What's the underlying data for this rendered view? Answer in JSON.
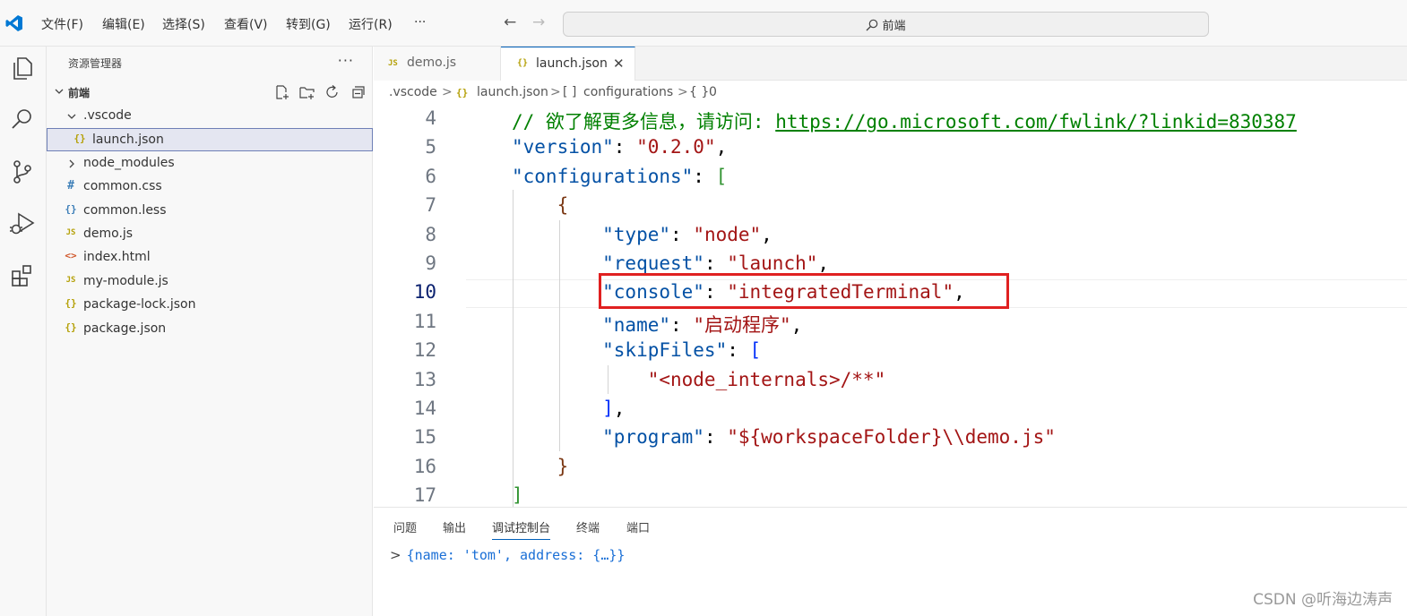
{
  "titlebar": {
    "menus": [
      "文件(F)",
      "编辑(E)",
      "选择(S)",
      "查看(V)",
      "转到(G)",
      "运行(R)",
      "···"
    ],
    "search_text": "前端"
  },
  "sidebar": {
    "title": "资源管理器",
    "more": "···",
    "folder": "前端",
    "items": [
      {
        "icon": "chevron",
        "label": ".vscode"
      },
      {
        "icon": "{}",
        "label": "launch.json"
      },
      {
        "icon": "chevron",
        "label": "node_modules"
      },
      {
        "icon": "#",
        "label": "common.css"
      },
      {
        "icon": "{}",
        "label": "common.less"
      },
      {
        "icon": "JS",
        "label": "demo.js"
      },
      {
        "icon": "<>",
        "label": "index.html"
      },
      {
        "icon": "JS",
        "label": "my-module.js"
      },
      {
        "icon": "{}",
        "label": "package-lock.json"
      },
      {
        "icon": "{}",
        "label": "package.json"
      }
    ]
  },
  "tabs": [
    {
      "icon": "JS",
      "label": "demo.js",
      "active": false
    },
    {
      "icon": "{}",
      "label": "launch.json",
      "active": true,
      "close": "✕"
    }
  ],
  "breadcrumb": [
    ".vscode",
    ">",
    "{}",
    "launch.json",
    ">",
    "[ ]",
    "configurations",
    ">",
    "{ }",
    "0"
  ],
  "editor": {
    "current_line": 10,
    "lines": [
      {
        "n": "4",
        "tokens": [
          [
            "comment",
            "// 欲了解更多信息，请访问: "
          ],
          [
            "link",
            "https://go.microsoft.com/fwlink/?linkid=830387"
          ]
        ]
      },
      {
        "n": "5",
        "tokens": [
          [
            "key",
            "\"version\""
          ],
          [
            "punc",
            ": "
          ],
          [
            "str",
            "\"0.2.0\""
          ],
          [
            "punc",
            ","
          ]
        ]
      },
      {
        "n": "6",
        "tokens": [
          [
            "key",
            "\"configurations\""
          ],
          [
            "punc",
            ": "
          ],
          [
            "b2",
            "["
          ]
        ]
      },
      {
        "n": "7",
        "tokens": [
          [
            "b3",
            "    {"
          ]
        ]
      },
      {
        "n": "8",
        "tokens": [
          [
            "key",
            "        \"type\""
          ],
          [
            "punc",
            ": "
          ],
          [
            "str",
            "\"node\""
          ],
          [
            "punc",
            ","
          ]
        ]
      },
      {
        "n": "9",
        "tokens": [
          [
            "key",
            "        \"request\""
          ],
          [
            "punc",
            ": "
          ],
          [
            "str",
            "\"launch\""
          ],
          [
            "punc",
            ","
          ]
        ]
      },
      {
        "n": "10",
        "tokens": [
          [
            "key",
            "        \"console\""
          ],
          [
            "punc",
            ": "
          ],
          [
            "str",
            "\"integratedTerminal\""
          ],
          [
            "punc",
            ","
          ]
        ]
      },
      {
        "n": "11",
        "tokens": [
          [
            "key",
            "        \"name\""
          ],
          [
            "punc",
            ": "
          ],
          [
            "str",
            "\"启动程序\""
          ],
          [
            "punc",
            ","
          ]
        ]
      },
      {
        "n": "12",
        "tokens": [
          [
            "key",
            "        \"skipFiles\""
          ],
          [
            "punc",
            ": "
          ],
          [
            "b1",
            "["
          ]
        ]
      },
      {
        "n": "13",
        "tokens": [
          [
            "str",
            "            \"<node_internals>/**\""
          ]
        ]
      },
      {
        "n": "14",
        "tokens": [
          [
            "b1",
            "        ]"
          ],
          [
            "punc",
            ","
          ]
        ]
      },
      {
        "n": "15",
        "tokens": [
          [
            "key",
            "        \"program\""
          ],
          [
            "punc",
            ": "
          ],
          [
            "str",
            "\"${workspaceFolder}\\\\demo.js\""
          ]
        ]
      },
      {
        "n": "16",
        "tokens": [
          [
            "b3",
            "    }"
          ]
        ]
      },
      {
        "n": "17",
        "tokens": [
          [
            "b2",
            "]"
          ]
        ]
      }
    ]
  },
  "panel": {
    "tabs": [
      "问题",
      "输出",
      "调试控制台",
      "终端",
      "端口"
    ],
    "active_tab": "调试控制台",
    "console_caret": ">",
    "console_output": "{name: 'tom', address: {…}}"
  },
  "watermark": "CSDN @听海边涛声",
  "colors": {
    "accent": "#005fb8",
    "highlight_box": "#e02020"
  }
}
